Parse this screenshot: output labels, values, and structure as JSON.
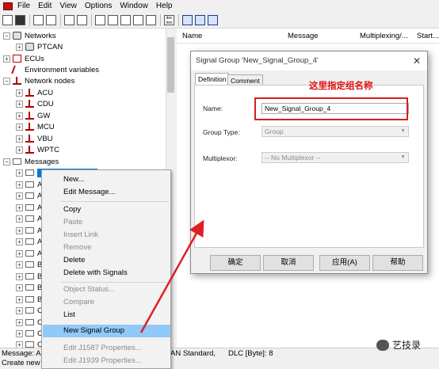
{
  "menu": [
    "File",
    "Edit",
    "View",
    "Options",
    "Window",
    "Help"
  ],
  "toolbar_icons": [
    "open-icon",
    "save-icon",
    "copy-icon",
    "paste-icon",
    "network-icon",
    "list-icon",
    "grid-icon",
    "grid-icon",
    "grid-icon",
    "grid-icon",
    "grid-icon",
    "dec-hex-icon",
    "window-icon",
    "window-icon",
    "window-icon"
  ],
  "toolbar_dechex_label": "dec\nhex",
  "tree": {
    "networks": "Networks",
    "ptcan": "PTCAN",
    "ecus": "ECUs",
    "env": "Environment variables",
    "nodes": "Network nodes",
    "node_items": [
      "ACU",
      "CDU",
      "GW",
      "MCU",
      "VBU",
      "WPTC"
    ],
    "messages": "Messages",
    "msg_items": [
      "AC",
      "AC",
      "AC",
      "AI",
      "AI",
      "AI",
      "AI",
      "BC",
      "BC",
      "BC",
      "BC",
      "CI",
      "CI",
      "CI",
      "CI"
    ]
  },
  "columns": [
    "Name",
    "Message",
    "Multiplexing/...",
    "Start..."
  ],
  "context_menu": {
    "items": [
      {
        "label": "New...",
        "disabled": false
      },
      {
        "label": "Edit Message...",
        "disabled": false
      },
      {
        "label": "Copy",
        "disabled": false
      },
      {
        "label": "Paste",
        "disabled": true
      },
      {
        "label": "Insert Link",
        "disabled": true
      },
      {
        "label": "Remove",
        "disabled": true
      },
      {
        "label": "Delete",
        "disabled": false
      },
      {
        "label": "Delete with Signals",
        "disabled": false
      },
      {
        "label": "Object Status...",
        "disabled": true
      },
      {
        "label": "Compare",
        "disabled": true
      },
      {
        "label": "List",
        "disabled": false
      },
      {
        "label": "New Signal Group",
        "disabled": false,
        "highlighted": true
      },
      {
        "label": "Edit J1587 Properties...",
        "disabled": true
      },
      {
        "label": "Edit J1939 Properties...",
        "disabled": true
      }
    ]
  },
  "dialog": {
    "title": "Signal Group 'New_Signal_Group_4'",
    "tabs": [
      "Definition",
      "Comment"
    ],
    "name_label": "Name:",
    "name_value": "New_Signal_Group_4",
    "group_type_label": "Group Type:",
    "group_type_value": "Group",
    "multiplexor_label": "Multiplexor:",
    "multiplexor_value": "-- No Multiplexor --",
    "buttons": [
      "确定",
      "取消",
      "应用(A)",
      "帮助"
    ]
  },
  "annotation": "这里指定组名称",
  "status": {
    "line1_left": "Message: AC",
    "line1_mid": "AN Standard,",
    "line1_right": "DLC [Byte]: 8",
    "line2": "Create new s"
  },
  "watermark": "艺技录",
  "colors": {
    "annotation_red": "#e01010",
    "highlight": "#91c9f7",
    "arrow_red": "#e02020"
  }
}
